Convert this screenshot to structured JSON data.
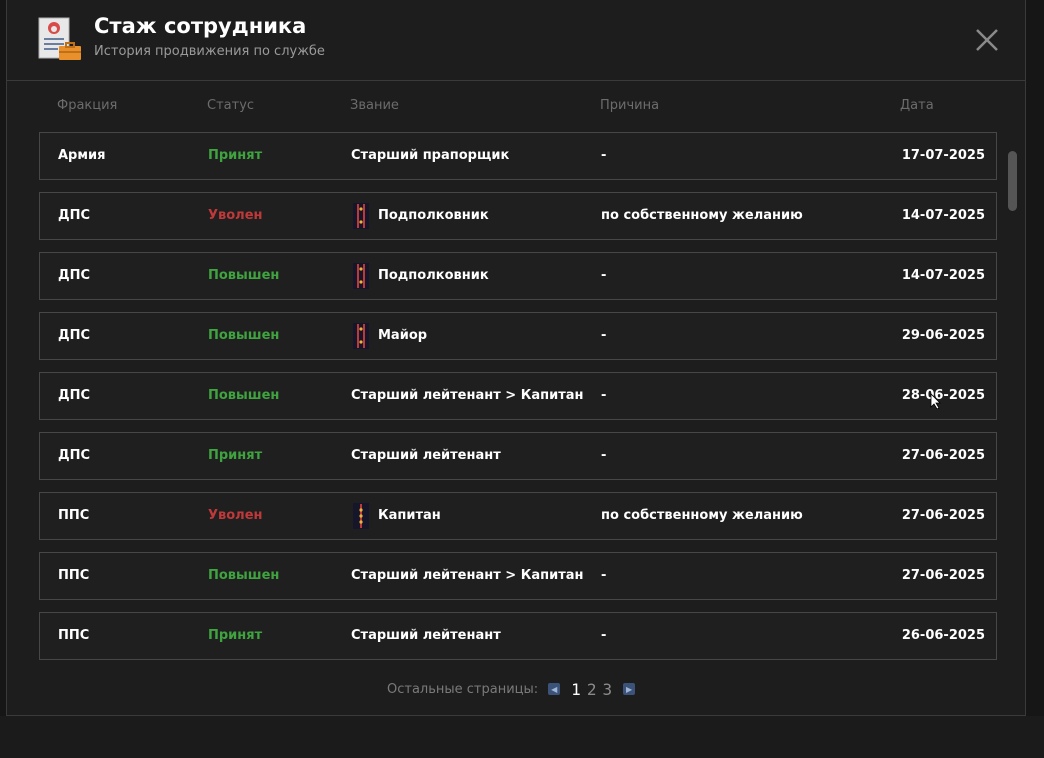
{
  "window": {
    "title": "Стаж сотрудника",
    "subtitle": "История продвижения по службе"
  },
  "columns": [
    "Фракция",
    "Статус",
    "Звание",
    "Причина",
    "Дата"
  ],
  "rows": [
    {
      "faction": "Армия",
      "status": "Принят",
      "status_color": "green",
      "rank": "Старший прапорщик",
      "rank_icon": null,
      "reason": "-",
      "date": "17-07-2025"
    },
    {
      "faction": "ДПС",
      "status": "Уволен",
      "status_color": "red",
      "rank": "Подполковник",
      "rank_icon": "two-stripe-rank-icon",
      "reason": "по собственному желанию",
      "date": "14-07-2025"
    },
    {
      "faction": "ДПС",
      "status": "Повышен",
      "status_color": "green",
      "rank": "Подполковник",
      "rank_icon": "two-stripe-rank-icon",
      "reason": "-",
      "date": "14-07-2025"
    },
    {
      "faction": "ДПС",
      "status": "Повышен",
      "status_color": "green",
      "rank": "Майор",
      "rank_icon": "two-stripe-rank-icon",
      "reason": "-",
      "date": "29-06-2025"
    },
    {
      "faction": "ДПС",
      "status": "Повышен",
      "status_color": "green",
      "rank": "Старший лейтенант > Капитан",
      "rank_icon": null,
      "reason": "-",
      "date": "28-06-2025"
    },
    {
      "faction": "ДПС",
      "status": "Принят",
      "status_color": "green",
      "rank": "Старший лейтенант",
      "rank_icon": null,
      "reason": "-",
      "date": "27-06-2025"
    },
    {
      "faction": "ППС",
      "status": "Уволен",
      "status_color": "red",
      "rank": "Капитан",
      "rank_icon": "one-stripe-rank-icon",
      "reason": "по собственному желанию",
      "date": "27-06-2025"
    },
    {
      "faction": "ППС",
      "status": "Повышен",
      "status_color": "green",
      "rank": "Старший лейтенант > Капитан",
      "rank_icon": null,
      "reason": "-",
      "date": "27-06-2025"
    },
    {
      "faction": "ППС",
      "status": "Принят",
      "status_color": "green",
      "rank": "Старший лейтенант",
      "rank_icon": null,
      "reason": "-",
      "date": "26-06-2025"
    }
  ],
  "pagination": {
    "label": "Остальные страницы:",
    "pages": [
      "1",
      "2",
      "3"
    ],
    "current": "1"
  },
  "colors": {
    "green": "#3fa33f",
    "red": "#c0393a",
    "accent_blue": "#3b5379"
  }
}
